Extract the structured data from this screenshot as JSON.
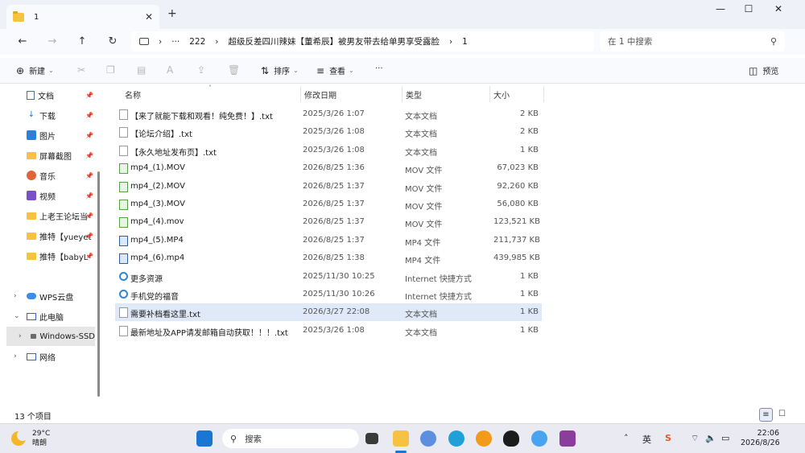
{
  "window": {
    "tab_title": "1",
    "controls": {
      "minimize": "—",
      "maximize": "☐",
      "close": "✕"
    }
  },
  "address": {
    "ellipsis": "···",
    "path": [
      "222",
      "超级反差四川辣妹【董希辰】被男友带去给单男享受露脸",
      "1"
    ],
    "search_placeholder": "在 1 中搜索"
  },
  "toolbar": {
    "new": "新建",
    "sort": "排序",
    "view": "查看",
    "more": "···",
    "preview": "预览"
  },
  "sidebar": {
    "quick": [
      {
        "label": "文档",
        "icon": "document-icon"
      },
      {
        "label": "下载",
        "icon": "download-icon"
      },
      {
        "label": "图片",
        "icon": "picture-icon"
      },
      {
        "label": "屏幕截图",
        "icon": "folder-icon"
      },
      {
        "label": "音乐",
        "icon": "music-icon"
      },
      {
        "label": "视频",
        "icon": "video-icon"
      },
      {
        "label": "上老王论坛当",
        "icon": "folder-icon"
      },
      {
        "label": "推特【yueyet",
        "icon": "folder-icon"
      },
      {
        "label": "推特【babyL",
        "icon": "folder-icon"
      }
    ],
    "tree": [
      {
        "label": "WPS云盘"
      },
      {
        "label": "此电脑"
      },
      {
        "label": "Windows-SSD"
      },
      {
        "label": "网络"
      }
    ]
  },
  "columns": {
    "name": "名称",
    "date": "修改日期",
    "type": "类型",
    "size": "大小"
  },
  "files": [
    {
      "name": "【来了就能下载和观看！纯免费！】.txt",
      "date": "2025/3/26 1:07",
      "type": "文本文档",
      "size": "2 KB",
      "kind": "txt"
    },
    {
      "name": "【论坛介绍】.txt",
      "date": "2025/3/26 1:08",
      "type": "文本文档",
      "size": "2 KB",
      "kind": "txt"
    },
    {
      "name": "【永久地址发布页】.txt",
      "date": "2025/3/26 1:08",
      "type": "文本文档",
      "size": "1 KB",
      "kind": "txt"
    },
    {
      "name": "mp4_(1).MOV",
      "date": "2026/8/25 1:36",
      "type": "MOV 文件",
      "size": "67,023 KB",
      "kind": "mov"
    },
    {
      "name": "mp4_(2).MOV",
      "date": "2026/8/25 1:37",
      "type": "MOV 文件",
      "size": "92,260 KB",
      "kind": "mov"
    },
    {
      "name": "mp4_(3).MOV",
      "date": "2026/8/25 1:37",
      "type": "MOV 文件",
      "size": "56,080 KB",
      "kind": "mov"
    },
    {
      "name": "mp4_(4).mov",
      "date": "2026/8/25 1:37",
      "type": "MOV 文件",
      "size": "123,521 KB",
      "kind": "mov"
    },
    {
      "name": "mp4_(5).MP4",
      "date": "2026/8/25 1:37",
      "type": "MP4 文件",
      "size": "211,737 KB",
      "kind": "mp4"
    },
    {
      "name": "mp4_(6).mp4",
      "date": "2026/8/25 1:38",
      "type": "MP4 文件",
      "size": "439,985 KB",
      "kind": "mp4"
    },
    {
      "name": "更多资源",
      "date": "2025/11/30 10:25",
      "type": "Internet 快捷方式",
      "size": "1 KB",
      "kind": "url"
    },
    {
      "name": "手机党的福音",
      "date": "2025/11/30 10:26",
      "type": "Internet 快捷方式",
      "size": "1 KB",
      "kind": "url"
    },
    {
      "name": "需要补档看这里.txt",
      "date": "2026/3/27 22:08",
      "type": "文本文档",
      "size": "1 KB",
      "kind": "txt",
      "selected": true
    },
    {
      "name": "最新地址及APP请发邮箱自动获取！！！.txt",
      "date": "2025/3/26 1:08",
      "type": "文本文档",
      "size": "1 KB",
      "kind": "txt"
    }
  ],
  "status": {
    "count": "13 个项目"
  },
  "taskbar": {
    "weather_temp": "29°C",
    "weather_desc": "晴朗",
    "search_label": "搜索",
    "ime_char": "英",
    "time": "22:06",
    "date": "2026/8/26"
  }
}
